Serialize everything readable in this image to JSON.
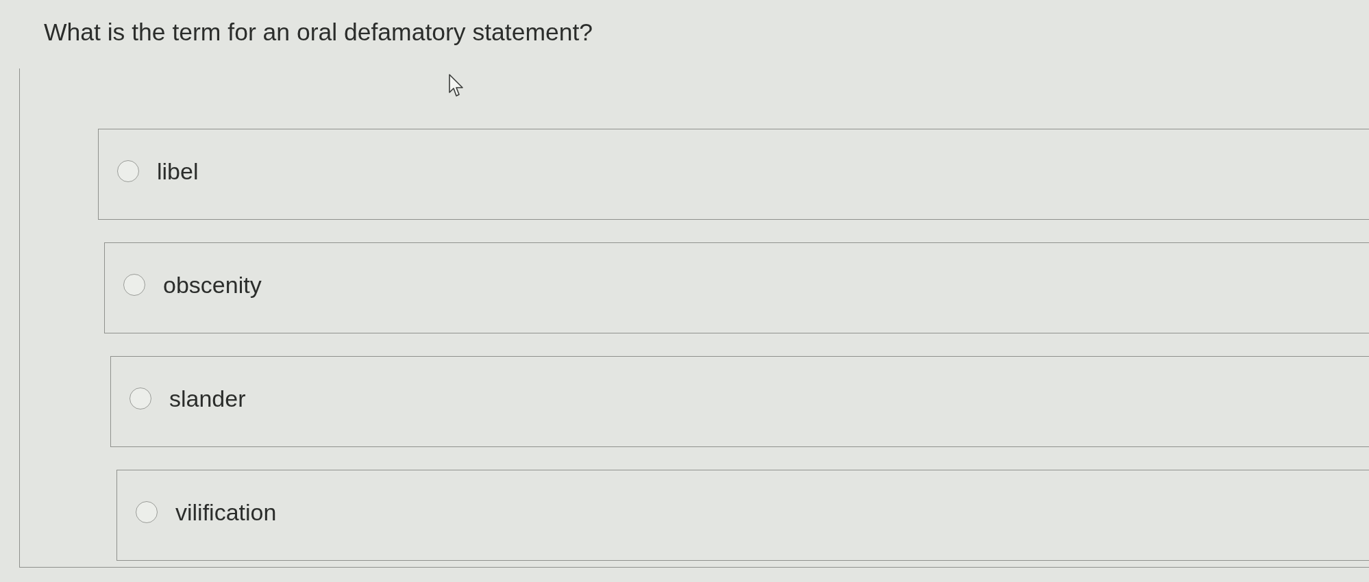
{
  "question": {
    "text": "What is the term for an oral defamatory statement?"
  },
  "options": [
    {
      "label": "libel",
      "selected": false
    },
    {
      "label": "obscenity",
      "selected": false
    },
    {
      "label": "slander",
      "selected": false
    },
    {
      "label": "vilification",
      "selected": false
    }
  ]
}
